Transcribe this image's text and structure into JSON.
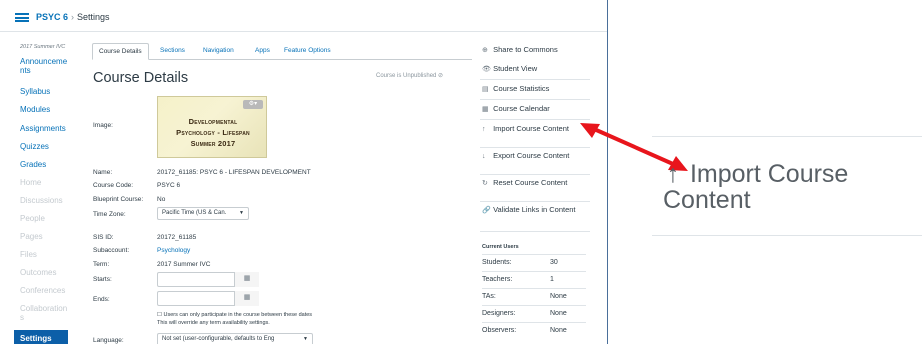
{
  "breadcrumb": {
    "course": "PSYC 6",
    "separator": "›",
    "page": "Settings"
  },
  "nav": {
    "term": "2017 Summer IVC",
    "items": [
      {
        "label": "Announcements",
        "muted": false
      },
      {
        "label": "Syllabus",
        "muted": false
      },
      {
        "label": "Modules",
        "muted": false
      },
      {
        "label": "Assignments",
        "muted": false
      },
      {
        "label": "Quizzes",
        "muted": false
      },
      {
        "label": "Grades",
        "muted": false
      },
      {
        "label": "Home",
        "muted": true
      },
      {
        "label": "Discussions",
        "muted": true
      },
      {
        "label": "People",
        "muted": true
      },
      {
        "label": "Pages",
        "muted": true
      },
      {
        "label": "Files",
        "muted": true
      },
      {
        "label": "Outcomes",
        "muted": true
      },
      {
        "label": "Conferences",
        "muted": true
      },
      {
        "label": "Collaborations",
        "muted": true
      }
    ],
    "active": "Settings"
  },
  "tabs": [
    "Course Details",
    "Sections",
    "Navigation",
    "Apps",
    "Feature Options"
  ],
  "details": {
    "heading": "Course Details",
    "unpublished": "Course is Unpublished",
    "image_label": "Image:",
    "banner": {
      "line1": "Developmental",
      "line2": "Psychology - Lifespan",
      "line3": "Summer 2017"
    },
    "name_label": "Name:",
    "name": "20172_61185: PSYC 6 - LIFESPAN DEVELOPMENT",
    "code_label": "Course Code:",
    "code": "PSYC 6",
    "blueprint_label": "Blueprint Course:",
    "blueprint": "No",
    "timezone_label": "Time Zone:",
    "timezone": "Pacific Time (US & Can.",
    "sis_label": "SIS ID:",
    "sis": "20172_61185",
    "subaccount_label": "Subaccount:",
    "subaccount": "Psychology",
    "term_label": "Term:",
    "term": "2017 Summer IVC",
    "starts_label": "Starts:",
    "ends_label": "Ends:",
    "note1": "Users can only participate in the course between these dates",
    "note2": "This will override any term availability settings.",
    "language_label": "Language:",
    "language": "Not set (user-configurable, defaults to Eng"
  },
  "sidebar": {
    "links": [
      {
        "icon": "⊕",
        "label": "Share to Commons"
      },
      {
        "icon": "👁",
        "label": "Student View"
      },
      {
        "icon": "▤",
        "label": "Course Statistics"
      },
      {
        "icon": "▦",
        "label": "Course Calendar"
      },
      {
        "icon": "↑",
        "label": "Import Course Content"
      },
      {
        "icon": "↓",
        "label": "Export Course Content"
      },
      {
        "icon": "↻",
        "label": "Reset Course Content"
      },
      {
        "icon": "🔗",
        "label": "Validate Links in Content"
      }
    ],
    "users_title": "Current Users",
    "users": [
      {
        "role": "Students:",
        "count": "30"
      },
      {
        "role": "Teachers:",
        "count": "1"
      },
      {
        "role": "TAs:",
        "count": "None"
      },
      {
        "role": "Designers:",
        "count": "None"
      },
      {
        "role": "Observers:",
        "count": "None"
      }
    ]
  },
  "zoom": {
    "icon": "↑",
    "line1": "Import Course",
    "line2": "Content"
  },
  "colors": {
    "link": "#0772b8",
    "active_nav": "#0c5fa8",
    "arrow": "#e8151c"
  }
}
